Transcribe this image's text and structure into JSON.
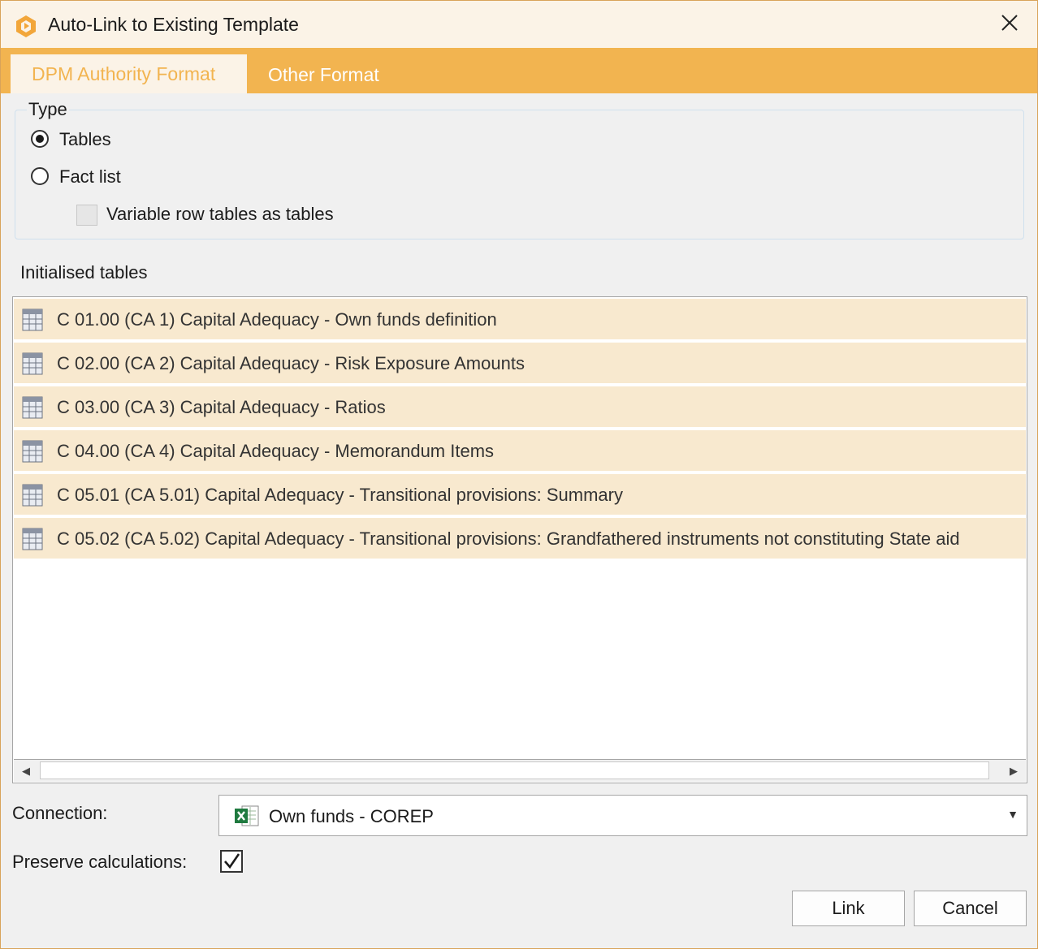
{
  "window": {
    "title": "Auto-Link to Existing Template",
    "icons": {
      "app": "app-logo-icon",
      "close": "close-icon"
    }
  },
  "tabs": [
    {
      "label": "DPM Authority Format",
      "active": true
    },
    {
      "label": "Other Format",
      "active": false
    }
  ],
  "type_group": {
    "legend": "Type",
    "options": [
      {
        "label": "Tables",
        "checked": true
      },
      {
        "label": "Fact list",
        "checked": false
      }
    ],
    "variable_rows": {
      "label": "Variable row tables as tables",
      "checked": false,
      "enabled": false
    }
  },
  "tables": {
    "label": "Initialised tables",
    "items": [
      "C 01.00 (CA 1) Capital Adequacy - Own funds definition",
      "C 02.00 (CA 2) Capital Adequacy - Risk Exposure Amounts",
      "C 03.00 (CA 3) Capital Adequacy - Ratios",
      "C 04.00 (CA 4) Capital Adequacy - Memorandum Items",
      "C 05.01 (CA 5.01) Capital Adequacy - Transitional provisions: Summary",
      "C 05.02 (CA 5.02) Capital Adequacy - Transitional provisions: Grandfathered instruments not constituting State aid"
    ]
  },
  "connection": {
    "label": "Connection:",
    "value": "Own funds - COREP",
    "icon": "excel-icon"
  },
  "preserve": {
    "label": "Preserve calculations:",
    "checked": true
  },
  "buttons": {
    "link": "Link",
    "cancel": "Cancel"
  },
  "colors": {
    "accent": "#f2b450",
    "row_highlight": "#f8e9cf",
    "title_bg": "#fbf3e7"
  }
}
